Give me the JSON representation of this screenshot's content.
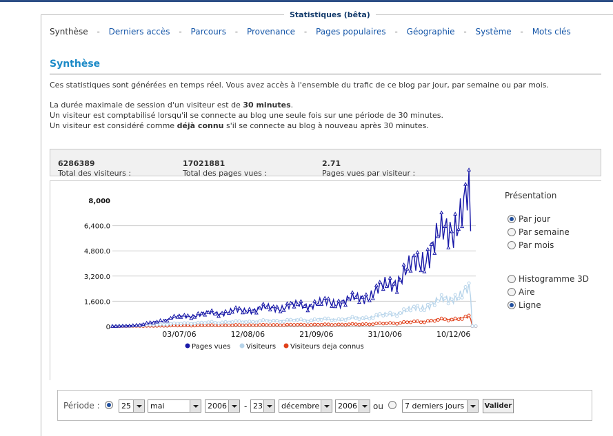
{
  "panel_title": "Statistiques (bêta)",
  "nav": {
    "current": "Synthèse",
    "separator": "-",
    "links": [
      "Derniers accès",
      "Parcours",
      "Provenance",
      "Pages populaires",
      "Géographie",
      "Système",
      "Mots clés"
    ]
  },
  "heading": "Synthèse",
  "intro": "Ces statistiques sont générées en temps réel. Vous avez accès à l'ensemble du trafic de ce blog par jour, par semaine ou par mois.",
  "session": {
    "line1_prefix": "La durée maximale de session d'un visiteur est de ",
    "line1_bold": "30 minutes",
    "line1_suffix": ".",
    "line2": "Un visiteur est comptabilisé lorsqu'il se connecte au blog une seule fois sur une période de 30 minutes.",
    "line3_prefix": "Un visiteur est considéré comme ",
    "line3_bold": "déjà connu",
    "line3_suffix": " s'il se connecte au blog à nouveau après 30 minutes."
  },
  "totals": {
    "visitors_label": "Total des visiteurs : ",
    "visitors_value": "6286389",
    "pages_label": "Total des pages vues : ",
    "pages_value": "17021881",
    "ratio_label": "Pages vues par visiteur : ",
    "ratio_value": "2.71"
  },
  "presentation": {
    "title": "Présentation",
    "period_options": [
      "Par jour",
      "Par semaine",
      "Par mois"
    ],
    "period_selected": "Par jour",
    "chart_options": [
      "Histogramme 3D",
      "Aire",
      "Ligne"
    ],
    "chart_selected": "Ligne"
  },
  "chart_data": {
    "type": "line",
    "y_tick_labels": [
      "0",
      "1,600.0",
      "3,200.0",
      "4,800.0",
      "6,400.0",
      "8,000"
    ],
    "ylim": [
      0,
      8000
    ],
    "x_tick_labels": [
      "03/07/06",
      "12/08/06",
      "21/09/06",
      "31/10/06",
      "10/12/06"
    ],
    "x_tick_day_index": [
      39,
      79,
      119,
      159,
      199
    ],
    "start_day": "2006-05-25",
    "end_day": "2006-12-23",
    "grid": true,
    "legend_position": "bottom",
    "series": [
      {
        "name": "Pages vues",
        "color": "#1a1aa8",
        "values": [
          20,
          20,
          22,
          24,
          27,
          30,
          33,
          38,
          43,
          50,
          56,
          63,
          70,
          80,
          90,
          103,
          115,
          130,
          145,
          162,
          180,
          200,
          220,
          240,
          262,
          285,
          310,
          335,
          360,
          385,
          410,
          435,
          460,
          485,
          508,
          530,
          550,
          570,
          587,
          602,
          618,
          632,
          646,
          660,
          673,
          686,
          698,
          710,
          722,
          733,
          745,
          756,
          767,
          778,
          789,
          800,
          811,
          822,
          832,
          842,
          852,
          862,
          872,
          882,
          892,
          902,
          912,
          922,
          932,
          942,
          952,
          962,
          972,
          982,
          992,
          1002,
          1012,
          1022,
          1032,
          1042,
          1052,
          1062,
          1072,
          1082,
          1092,
          1102,
          1112,
          1122,
          1132,
          1142,
          1152,
          1162,
          1172,
          1182,
          1192,
          1202,
          1212,
          1222,
          1232,
          1242,
          1252,
          1262,
          1272,
          1282,
          1292,
          1302,
          1312,
          1322,
          1332,
          1342,
          1352,
          1362,
          1372,
          1382,
          1392,
          1402,
          1412,
          1422,
          1432,
          1442,
          1452,
          1462,
          1472,
          1482,
          1492,
          1502,
          1512,
          1522,
          1532,
          1542,
          1552,
          1562,
          1572,
          1582,
          1592,
          1602,
          1615,
          1630,
          1648,
          1668,
          1690,
          1715,
          1742,
          1772,
          1804,
          1838,
          1874,
          1912,
          1952,
          1994,
          2038,
          2084,
          2132,
          2182,
          2234,
          2288,
          2344,
          2402,
          2462,
          2524,
          2588,
          2654,
          2722,
          2792,
          2864,
          2938,
          3014,
          3092,
          3172,
          3254,
          3338,
          3424,
          3512,
          3602,
          3694,
          3788,
          3884,
          3982,
          4082,
          4184,
          4288,
          4394,
          4502,
          4612,
          4724,
          4838,
          4954,
          5072,
          5192,
          5314,
          5438,
          5564,
          5692,
          5822,
          5954,
          6088,
          6224,
          6362,
          6502,
          6644,
          6788,
          6934,
          7082,
          7232,
          7384,
          7538,
          7694,
          7852,
          8012,
          6050
        ]
      },
      {
        "name": "Visiteurs",
        "color": "#b7d4ea",
        "values": []
      },
      {
        "name": "Visiteurs deja connus",
        "color": "#e0401a",
        "values": []
      }
    ]
  },
  "period": {
    "label": "Période :",
    "day_from": "25",
    "month_from": "mai",
    "year_from": "2006",
    "day_to": "23",
    "month_to": "décembre",
    "year_to": "2006",
    "or_label": "ou",
    "preset": "7 derniers jours",
    "submit": "Valider"
  }
}
